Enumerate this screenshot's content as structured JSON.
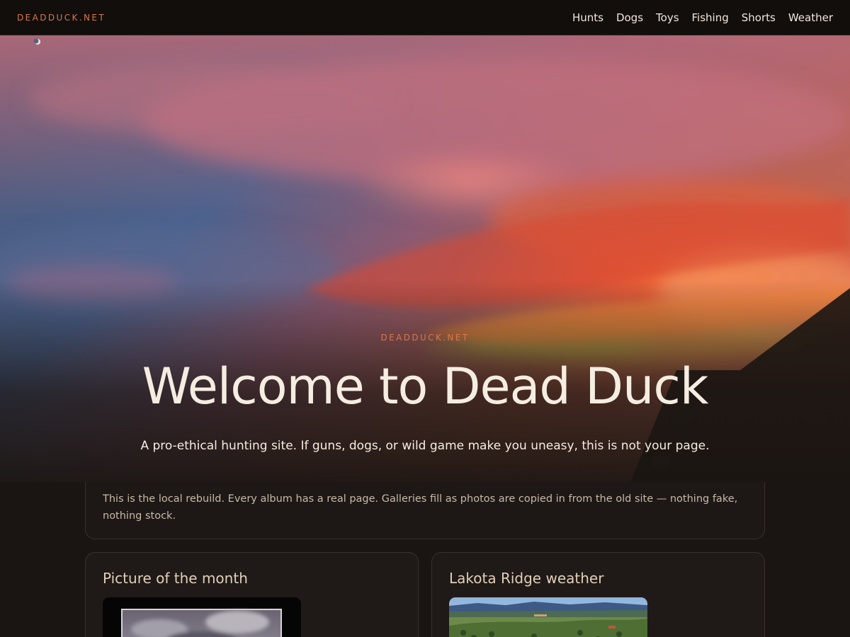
{
  "header": {
    "brand": "DEADDUCK.NET",
    "nav": [
      "Hunts",
      "Dogs",
      "Toys",
      "Fishing",
      "Shorts",
      "Weather"
    ]
  },
  "hero": {
    "eyebrow": "DEADDUCK.NET",
    "title": "Welcome to Dead Duck",
    "subtitle": "A pro-ethical hunting site. If guns, dogs, or wild game make you uneasy, this is not your page."
  },
  "notice": {
    "text": "This is the local rebuild. Every album has a real page. Galleries fill as photos are copied in from the old site — nothing fake, nothing stock."
  },
  "cards": {
    "picture_of_month": {
      "title": "Picture of the month"
    },
    "weather": {
      "title": "Lakota Ridge weather"
    }
  },
  "colors": {
    "accent": "#d9774a",
    "background": "#1a1512",
    "text": "#f6ede1"
  }
}
